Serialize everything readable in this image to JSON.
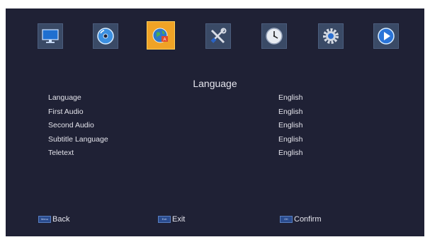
{
  "menu": {
    "items": [
      {
        "icon": "monitor-icon",
        "active": false
      },
      {
        "icon": "disc-icon",
        "active": false
      },
      {
        "icon": "globe-language-icon",
        "active": true
      },
      {
        "icon": "tools-icon",
        "active": false
      },
      {
        "icon": "clock-icon",
        "active": false
      },
      {
        "icon": "gear-icon",
        "active": false
      },
      {
        "icon": "play-icon",
        "active": false
      }
    ]
  },
  "page": {
    "title": "Language"
  },
  "settings": [
    {
      "label": "Language",
      "value": "English"
    },
    {
      "label": "First Audio",
      "value": "English"
    },
    {
      "label": "Second Audio",
      "value": "English"
    },
    {
      "label": "Subtitle Language",
      "value": "English"
    },
    {
      "label": "Teletext",
      "value": "English"
    }
  ],
  "footer": {
    "back": {
      "key": "Menu",
      "label": "Back"
    },
    "exit": {
      "key": "Exit",
      "label": "Exit"
    },
    "confirm": {
      "key": "OK",
      "label": "Confirm"
    }
  },
  "colors": {
    "background": "#1f2135",
    "active_tab": "#f0a326",
    "text": "#e3e3ea"
  }
}
